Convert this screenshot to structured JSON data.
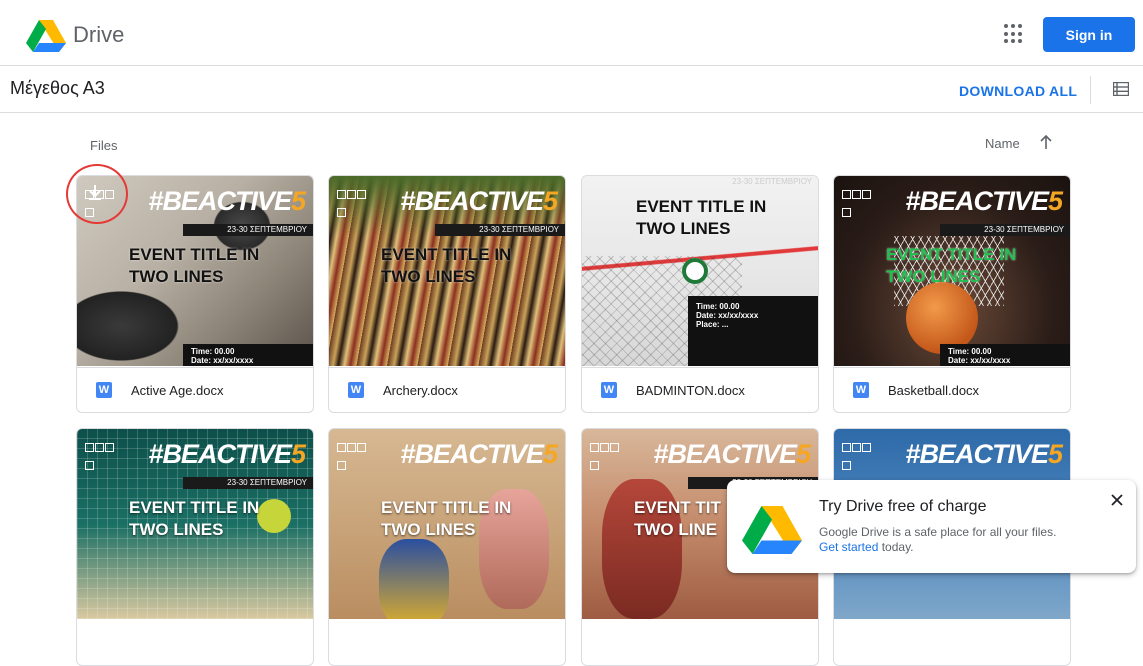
{
  "header": {
    "app_name": "Drive",
    "sign_in_label": "Sign in"
  },
  "folder": {
    "title": "Μέγεθος Α3",
    "download_all_label": "DOWNLOAD ALL"
  },
  "files_section": {
    "label": "Files",
    "sort_label": "Name"
  },
  "files": [
    {
      "name": "Active Age.docx",
      "type_badge": "W",
      "thumb": {
        "brand_a": "#BE",
        "brand_b": "ACTIVE",
        "brand_num": "5",
        "event_line1": "EVENT TITLE IN",
        "event_line2": "TWO LINES",
        "time": "Time: 00.00",
        "date": "Date: xx/xx/xxxx",
        "datebar": "23-30 ΣΕΠΤΕΜΒΡΙΟΥ"
      }
    },
    {
      "name": "Archery.docx",
      "type_badge": "W",
      "thumb": {
        "brand_a": "#BE",
        "brand_b": "ACTIVE",
        "brand_num": "5",
        "event_line1": "EVENT TITLE IN",
        "event_line2": "TWO LINES",
        "datebar": "23-30 ΣΕΠΤΕΜΒΡΙΟΥ"
      }
    },
    {
      "name": "BADMINTON.docx",
      "type_badge": "W",
      "thumb": {
        "event_line1": "EVENT TITLE IN",
        "event_line2": "TWO LINES",
        "time": "Time: 00.00",
        "date": "Date: xx/xx/xxxx",
        "place": "Place: ...",
        "datebar": "23-30 ΣΕΠΤΕΜΒΡΙΟΥ"
      }
    },
    {
      "name": "Basketball.docx",
      "type_badge": "W",
      "thumb": {
        "brand_a": "#BE",
        "brand_b": "ACTIVE",
        "brand_num": "5",
        "event_line1": "EVENT TITLE IN",
        "event_line2": "TWO LINES",
        "time": "Time: 00.00",
        "date": "Date: xx/xx/xxxx",
        "datebar": "23-30 ΣΕΠΤΕΜΒΡΙΟΥ"
      }
    },
    {
      "thumb": {
        "brand_a": "#BE",
        "brand_b": "ACTIVE",
        "brand_num": "5",
        "event_line1": "EVENT TITLE IN",
        "event_line2": "TWO LINES",
        "datebar": "23-30 ΣΕΠΤΕΜΒΡΙΟΥ"
      }
    },
    {
      "thumb": {
        "brand_a": "#BE",
        "brand_b": "ACTIVE",
        "brand_num": "5",
        "event_line1": "EVENT TITLE IN",
        "event_line2": "TWO LINES"
      }
    },
    {
      "thumb": {
        "brand_a": "#BE",
        "brand_b": "ACTIVE",
        "brand_num": "5",
        "event_line1": "EVENT TIT",
        "event_line2": "TWO LINE",
        "datebar": "23-30 ΣΕΠΤΕΜΒΡΙΟΥ"
      }
    },
    {
      "thumb": {
        "brand_a": "#BE",
        "brand_b": "ACTIVE",
        "brand_num": "5"
      }
    }
  ],
  "toast": {
    "title": "Try Drive free of charge",
    "body": "Google Drive is a safe place for all your files.",
    "link": "Get started",
    "suffix": " today."
  },
  "colors": {
    "accent": "#1a73e8",
    "highlight_circle": "#e53935",
    "brand_orange": "#f5a623"
  },
  "icons": [
    "drive-logo-icon",
    "apps-grid-icon",
    "list-view-icon",
    "sort-arrow-up-icon",
    "download-icon",
    "close-icon",
    "word-doc-icon"
  ]
}
